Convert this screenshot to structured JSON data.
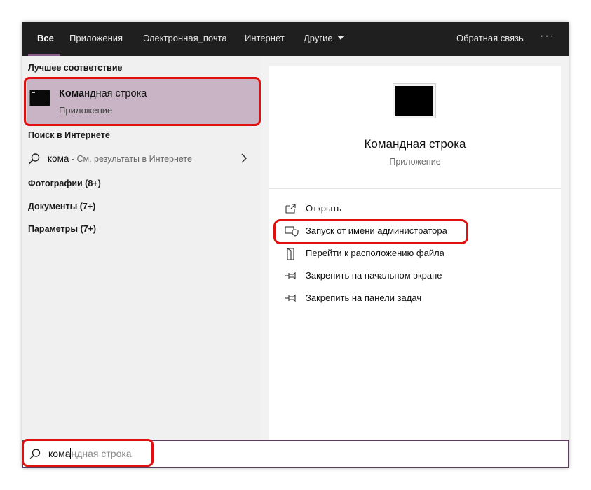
{
  "topbar": {
    "tabs": [
      {
        "label": "Все",
        "active": true
      },
      {
        "label": "Приложения"
      },
      {
        "label": "Электронная_почта"
      },
      {
        "label": "Интернет"
      },
      {
        "label": "Другие"
      }
    ],
    "feedback_label": "Обратная связь",
    "more_label": "···"
  },
  "left": {
    "best_match_heading": "Лучшее соответствие",
    "best_match": {
      "title_bold": "Кома",
      "title_rest": "ндная строка",
      "subtitle": "Приложение"
    },
    "web_heading": "Поиск в Интернете",
    "web_result": {
      "query": "кома",
      "description": " - См. результаты в Интернете"
    },
    "photos_heading": "Фотографии (8+)",
    "documents_heading": "Документы (7+)",
    "settings_heading": "Параметры (7+)"
  },
  "right": {
    "title": "Командная строка",
    "subtitle": "Приложение",
    "actions": [
      {
        "label": "Открыть",
        "icon": "open-icon"
      },
      {
        "label": "Запуск от имени администратора",
        "icon": "run-as-admin-icon"
      },
      {
        "label": "Перейти к расположению файла",
        "icon": "file-location-icon"
      },
      {
        "label": "Закрепить на начальном экране",
        "icon": "pin-icon"
      },
      {
        "label": "Закрепить на панели задач",
        "icon": "pin-icon"
      }
    ]
  },
  "searchbar": {
    "typed": "кома",
    "suggestion": "ндная строка"
  },
  "colors": {
    "topbar_bg": "#1f1f1f",
    "accent": "#8a5d8a",
    "selected_bg": "#c8b4c4",
    "highlight_red": "#e01010"
  }
}
